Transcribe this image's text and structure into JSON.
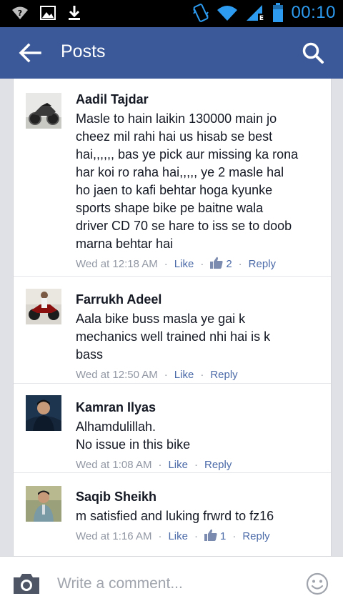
{
  "status_bar": {
    "time": "00:10"
  },
  "header": {
    "title": "Posts"
  },
  "comments": [
    {
      "author": "Aadil Tajdar",
      "text": "Masle to hain laikin 130000 main jo\ncheez mil rahi hai us hisab se best\nhai,,,,,, bas ye pick aur missing ka rona\nhar koi ro raha hai,,,,, ye 2 masle hal\nho jaen to kafi behtar hoga kyunke\nsports shape bike pe baitne wala\ndriver CD 70 se hare to iss se to doob\nmarna behtar hai",
      "time": "Wed at 12:18 AM",
      "like_label": "Like",
      "reply_label": "Reply",
      "likes": "2"
    },
    {
      "author": "Farrukh Adeel",
      "text": "Aala bike buss masla ye gai k\nmechanics well trained nhi hai is k\nbass",
      "time": "Wed at 12:50 AM",
      "like_label": "Like",
      "reply_label": "Reply"
    },
    {
      "author": "Kamran Ilyas",
      "text": "Alhamdulillah.\nNo issue in this bike",
      "time": "Wed at 1:08 AM",
      "like_label": "Like",
      "reply_label": "Reply"
    },
    {
      "author": "Saqib Sheikh",
      "text": "m satisfied and luking frwrd to fz16",
      "time": "Wed at 1:16 AM",
      "like_label": "Like",
      "reply_label": "Reply",
      "likes": "1"
    }
  ],
  "composer": {
    "placeholder": "Write a comment..."
  },
  "colors": {
    "appbar": "#3b5998",
    "link": "#4b6aa8",
    "status_accent": "#2d9bf0"
  },
  "icons": [
    "signal-question-icon",
    "image-icon",
    "download-icon",
    "vibrate-icon",
    "wifi-icon",
    "cell-signal-icon",
    "battery-icon",
    "back-arrow-icon",
    "search-icon",
    "thumbs-up-icon",
    "camera-icon",
    "smiley-icon"
  ]
}
